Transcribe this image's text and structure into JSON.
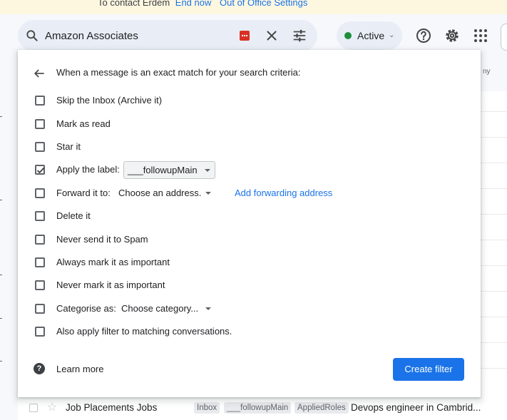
{
  "banner": {
    "text": "To contact Erdem",
    "end_now": "End now",
    "settings": "Out of Office Settings"
  },
  "search": {
    "value": "Amazon Associates"
  },
  "status": {
    "label": "Active",
    "color": "#1e8e3e"
  },
  "background": {
    "column_label": "ny"
  },
  "dialog": {
    "header": "When a message is an exact match for your search criteria:",
    "options": [
      {
        "label": "Skip the Inbox (Archive it)",
        "checked": false
      },
      {
        "label": "Mark as read",
        "checked": false
      },
      {
        "label": "Star it",
        "checked": false
      },
      {
        "label": "Apply the label:",
        "checked": true,
        "select_value": "___followupMain"
      },
      {
        "label": "Forward it to:",
        "checked": false,
        "select_value": "Choose an address.",
        "link": "Add forwarding address"
      },
      {
        "label": "Delete it",
        "checked": false
      },
      {
        "label": "Never send it to Spam",
        "checked": false
      },
      {
        "label": "Always mark it as important",
        "checked": false
      },
      {
        "label": "Never mark it as important",
        "checked": false
      },
      {
        "label": "Categorise as:",
        "checked": false,
        "select_value": "Choose category..."
      },
      {
        "label": "Also apply filter to matching conversations.",
        "checked": false
      }
    ],
    "learn_more": "Learn more",
    "create_button": "Create filter",
    "help_glyph": "?"
  },
  "mail_row": {
    "sender": "Job Placements Jobs",
    "tags": [
      "Inbox",
      "___followupMain",
      "AppliedRoles"
    ],
    "subject": "Devops engineer in Cambrid..."
  },
  "colors": {
    "accent": "#1a73e8",
    "banner_bg": "#fef7e0"
  }
}
